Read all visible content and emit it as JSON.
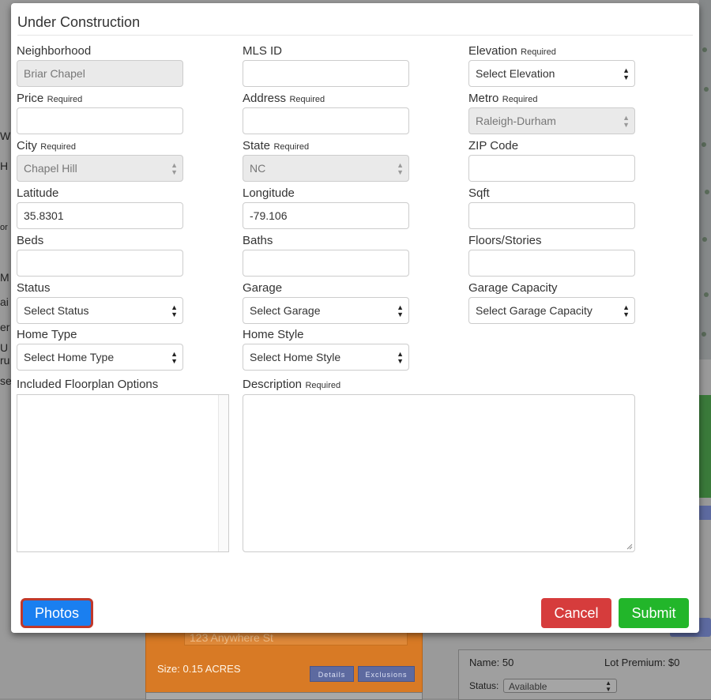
{
  "background": {
    "left_fragments": [
      "W",
      "H",
      "or",
      "M",
      "ai",
      "er",
      "U",
      "ru",
      "se"
    ],
    "address_placeholder": "123 Anywhere St",
    "size_text": "Size: 0.15 ACRES",
    "details_label": "Details",
    "exclusions_label": "Exclusions",
    "lot_name": "Name: 50",
    "lot_premium": "Lot Premium: $0",
    "lot_status_label": "Status:",
    "lot_status_value": "Available"
  },
  "modal": {
    "title": "Under Construction",
    "required_tag": "Required",
    "fields": {
      "neighborhood": {
        "label": "Neighborhood",
        "value": "Briar Chapel"
      },
      "mls_id": {
        "label": "MLS ID",
        "value": ""
      },
      "elevation": {
        "label": "Elevation",
        "value": "Select Elevation"
      },
      "price": {
        "label": "Price",
        "value": ""
      },
      "address": {
        "label": "Address",
        "value": ""
      },
      "metro": {
        "label": "Metro",
        "value": "Raleigh-Durham"
      },
      "city": {
        "label": "City",
        "value": "Chapel Hill"
      },
      "state": {
        "label": "State",
        "value": "NC"
      },
      "zip": {
        "label": "ZIP Code",
        "value": ""
      },
      "latitude": {
        "label": "Latitude",
        "value": "35.8301"
      },
      "longitude": {
        "label": "Longitude",
        "value": "-79.106"
      },
      "sqft": {
        "label": "Sqft",
        "value": ""
      },
      "beds": {
        "label": "Beds",
        "value": ""
      },
      "baths": {
        "label": "Baths",
        "value": ""
      },
      "floors": {
        "label": "Floors/Stories",
        "value": ""
      },
      "status": {
        "label": "Status",
        "value": "Select Status"
      },
      "garage": {
        "label": "Garage",
        "value": "Select Garage"
      },
      "garage_capacity": {
        "label": "Garage Capacity",
        "value": "Select Garage Capacity"
      },
      "home_type": {
        "label": "Home Type",
        "value": "Select Home Type"
      },
      "home_style": {
        "label": "Home Style",
        "value": "Select Home Style"
      },
      "floorplan_options": {
        "label": "Included Floorplan Options"
      },
      "description": {
        "label": "Description",
        "value": ""
      }
    },
    "buttons": {
      "photos": "Photos",
      "cancel": "Cancel",
      "submit": "Submit"
    }
  },
  "colors": {
    "photos_button": "#1a7ff0",
    "photos_outline": "#c0392b",
    "cancel_button": "#d63c3c",
    "submit_button": "#22b62a",
    "lot_card": "#d87a25"
  }
}
